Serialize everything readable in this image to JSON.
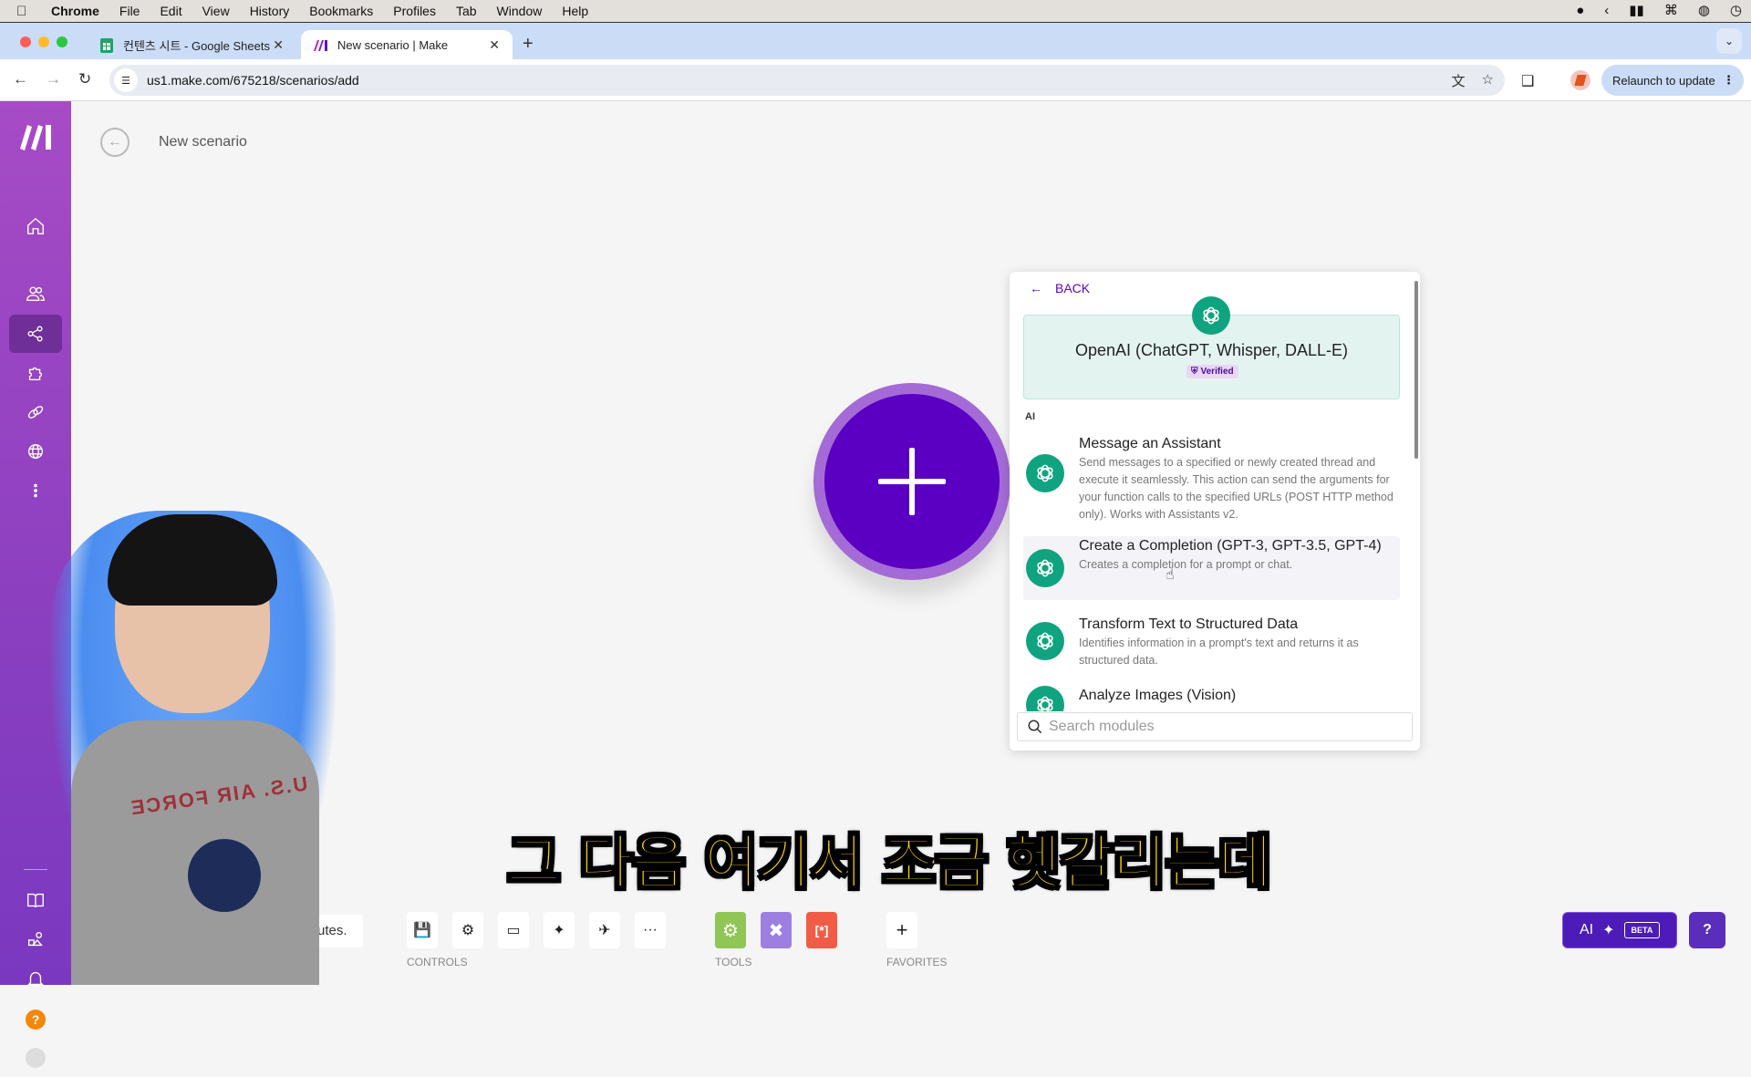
{
  "os_menubar": {
    "app": "Chrome",
    "items": [
      "File",
      "Edit",
      "View",
      "History",
      "Bookmarks",
      "Profiles",
      "Tab",
      "Window",
      "Help"
    ]
  },
  "browser": {
    "tabs": [
      {
        "title": "컨텐츠 시트 - Google Sheets",
        "icon": "google-sheets-icon",
        "active": false
      },
      {
        "title": "New scenario | Make",
        "icon": "make-icon",
        "active": true
      }
    ],
    "url": "us1.make.com/675218/scenarios/add",
    "relaunch_label": "Relaunch to update"
  },
  "sidebar": {
    "items": [
      {
        "name": "home",
        "active": false
      },
      {
        "name": "team",
        "active": false
      },
      {
        "name": "scenarios",
        "active": true
      },
      {
        "name": "templates",
        "active": false
      },
      {
        "name": "connections",
        "active": false
      },
      {
        "name": "webhooks",
        "active": false
      },
      {
        "name": "more",
        "active": false
      }
    ],
    "bottom_items": [
      "resource-hub",
      "whats-new",
      "notifications",
      "help",
      "profile"
    ]
  },
  "header": {
    "title": "New scenario"
  },
  "module_panel": {
    "back_label": "BACK",
    "app_name": "OpenAI (ChatGPT, Whisper, DALL-E)",
    "verified_label": "Verified",
    "section": "AI",
    "modules": [
      {
        "title": "Message an Assistant",
        "description": "Send messages to a specified or newly created thread and execute it seamlessly. This action can send the arguments for your function calls to the specified URLs (POST HTTP method only). Works with Assistants v2."
      },
      {
        "title": "Create a Completion (GPT-3, GPT-3.5, GPT-4)",
        "description": "Creates a completion for a prompt or chat."
      },
      {
        "title": "Transform Text to Structured Data",
        "description": "Identifies information in a prompt's text and returns it as structured data."
      },
      {
        "title": "Analyze Images (Vision)",
        "description": ""
      }
    ],
    "search_placeholder": "Search modules",
    "search_value": ""
  },
  "bottom_toolbar": {
    "toast_fragment": "utes.",
    "controls_label": "CONTROLS",
    "tools_label": "TOOLS",
    "favorites_label": "FAVORITES",
    "more_label": "···",
    "tools": [
      {
        "name": "flow-control",
        "color": "#8fc655"
      },
      {
        "name": "tools",
        "color": "#9c7fe0"
      },
      {
        "name": "text-parser",
        "color": "#f15c46",
        "glyph": "[*]"
      }
    ],
    "ai_label": "AI",
    "beta_label": "BETA"
  },
  "video_overlay": {
    "subtitle": "그 다음 여기서 조금 헷갈리는데",
    "shirt_text": "U.S. AIR FORCE"
  },
  "colors": {
    "make_purple": "#5b00c2",
    "openai_green": "#10a37f",
    "sidebar_top": "#a74bc6",
    "subtitle_yellow": "#ffd400"
  }
}
